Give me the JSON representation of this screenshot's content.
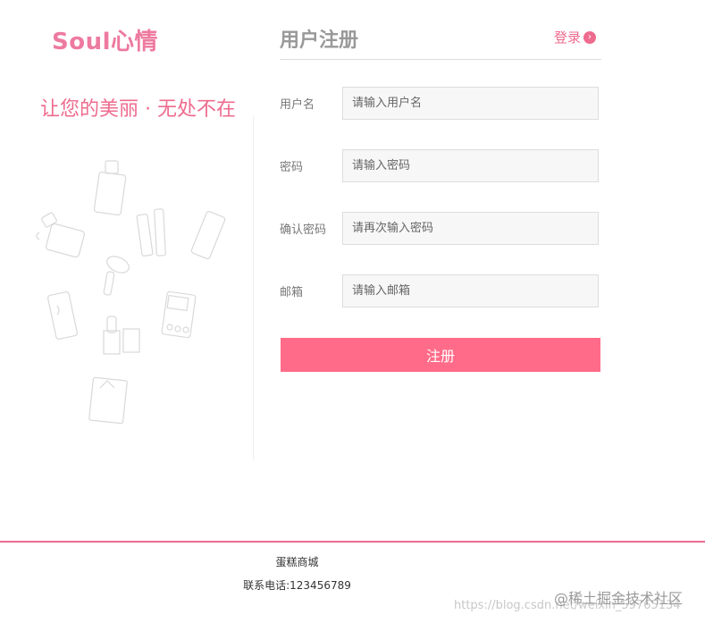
{
  "brand": {
    "name": "Soul心情",
    "slogan": "让您的美丽 · 无处不在"
  },
  "panel": {
    "title": "用户注册",
    "login_link": "登录"
  },
  "form": {
    "fields": [
      {
        "label": "用户名",
        "placeholder": "请输入用户名"
      },
      {
        "label": "密码",
        "placeholder": "请输入密码"
      },
      {
        "label": "确认密码",
        "placeholder": "请再次输入密码"
      },
      {
        "label": "邮箱",
        "placeholder": "请输入邮箱"
      }
    ],
    "submit_label": "注册"
  },
  "footer": {
    "shop_name": "蛋糕商城",
    "phone": "联系电话:123456789"
  },
  "watermark": {
    "url": "https://blog.csdn.net/weixin_59765134",
    "community": "@稀土掘金技术社区"
  },
  "colors": {
    "accent": "#ff6b88",
    "brand_pink": "#ee7aa0"
  }
}
